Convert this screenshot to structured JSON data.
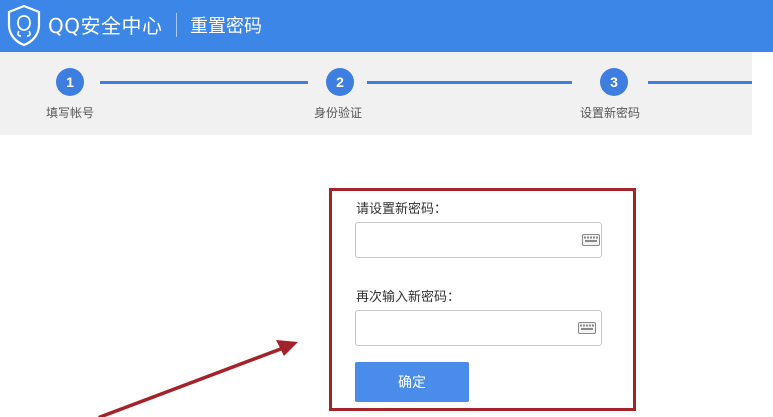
{
  "header": {
    "brand": "QQ安全中心",
    "subtitle": "重置密码"
  },
  "steps": [
    {
      "number": "1",
      "label": "填写帐号"
    },
    {
      "number": "2",
      "label": "身份验证"
    },
    {
      "number": "3",
      "label": "设置新密码"
    }
  ],
  "form": {
    "new_password_label": "请设置新密码：",
    "new_password_value": "",
    "confirm_password_label": "再次输入新密码：",
    "confirm_password_value": "",
    "submit_label": "确定"
  },
  "icons": {
    "logo": "shield-icon",
    "input_keyboard": "keyboard-icon"
  },
  "colors": {
    "header_bg": "#3b86e6",
    "step_accent": "#3d7ee0",
    "highlight_border": "#a3232a",
    "button_bg": "#4a8cea",
    "arrow": "#a3232a"
  }
}
